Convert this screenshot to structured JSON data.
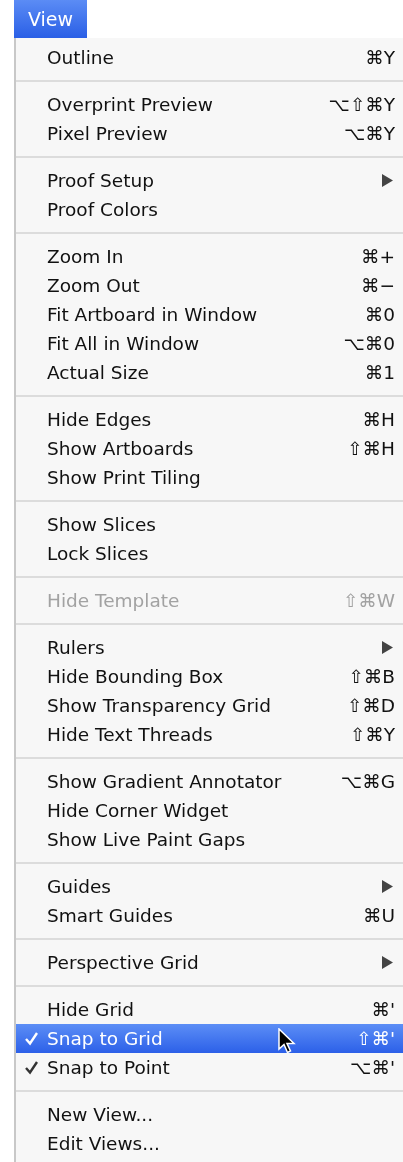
{
  "menu_title": "View",
  "sections": [
    {
      "items": [
        {
          "label": "Outline",
          "shortcut": "⌘Y",
          "submenu": false,
          "checked": false,
          "disabled": false,
          "selected": false
        }
      ]
    },
    {
      "items": [
        {
          "label": "Overprint Preview",
          "shortcut": "⌥⇧⌘Y",
          "submenu": false,
          "checked": false,
          "disabled": false,
          "selected": false
        },
        {
          "label": "Pixel Preview",
          "shortcut": "⌥⌘Y",
          "submenu": false,
          "checked": false,
          "disabled": false,
          "selected": false
        }
      ]
    },
    {
      "items": [
        {
          "label": "Proof Setup",
          "submenu": true,
          "checked": false,
          "disabled": false,
          "selected": false
        },
        {
          "label": "Proof Colors",
          "submenu": false,
          "checked": false,
          "disabled": false,
          "selected": false
        }
      ]
    },
    {
      "items": [
        {
          "label": "Zoom In",
          "shortcut": "⌘+",
          "submenu": false,
          "checked": false,
          "disabled": false,
          "selected": false
        },
        {
          "label": "Zoom Out",
          "shortcut": "⌘−",
          "submenu": false,
          "checked": false,
          "disabled": false,
          "selected": false
        },
        {
          "label": "Fit Artboard in Window",
          "shortcut": "⌘0",
          "submenu": false,
          "checked": false,
          "disabled": false,
          "selected": false
        },
        {
          "label": "Fit All in Window",
          "shortcut": "⌥⌘0",
          "submenu": false,
          "checked": false,
          "disabled": false,
          "selected": false
        },
        {
          "label": "Actual Size",
          "shortcut": "⌘1",
          "submenu": false,
          "checked": false,
          "disabled": false,
          "selected": false
        }
      ]
    },
    {
      "items": [
        {
          "label": "Hide Edges",
          "shortcut": "⌘H",
          "submenu": false,
          "checked": false,
          "disabled": false,
          "selected": false
        },
        {
          "label": "Show Artboards",
          "shortcut": "⇧⌘H",
          "submenu": false,
          "checked": false,
          "disabled": false,
          "selected": false
        },
        {
          "label": "Show Print Tiling",
          "submenu": false,
          "checked": false,
          "disabled": false,
          "selected": false
        }
      ]
    },
    {
      "items": [
        {
          "label": "Show Slices",
          "submenu": false,
          "checked": false,
          "disabled": false,
          "selected": false
        },
        {
          "label": "Lock Slices",
          "submenu": false,
          "checked": false,
          "disabled": false,
          "selected": false
        }
      ]
    },
    {
      "items": [
        {
          "label": "Hide Template",
          "shortcut": "⇧⌘W",
          "submenu": false,
          "checked": false,
          "disabled": true,
          "selected": false
        }
      ]
    },
    {
      "items": [
        {
          "label": "Rulers",
          "submenu": true,
          "checked": false,
          "disabled": false,
          "selected": false
        },
        {
          "label": "Hide Bounding Box",
          "shortcut": "⇧⌘B",
          "submenu": false,
          "checked": false,
          "disabled": false,
          "selected": false
        },
        {
          "label": "Show Transparency Grid",
          "shortcut": "⇧⌘D",
          "submenu": false,
          "checked": false,
          "disabled": false,
          "selected": false
        },
        {
          "label": "Hide Text Threads",
          "shortcut": "⇧⌘Y",
          "submenu": false,
          "checked": false,
          "disabled": false,
          "selected": false
        }
      ]
    },
    {
      "items": [
        {
          "label": "Show Gradient Annotator",
          "shortcut": "⌥⌘G",
          "submenu": false,
          "checked": false,
          "disabled": false,
          "selected": false
        },
        {
          "label": "Hide Corner Widget",
          "submenu": false,
          "checked": false,
          "disabled": false,
          "selected": false
        },
        {
          "label": "Show Live Paint Gaps",
          "submenu": false,
          "checked": false,
          "disabled": false,
          "selected": false
        }
      ]
    },
    {
      "items": [
        {
          "label": "Guides",
          "submenu": true,
          "checked": false,
          "disabled": false,
          "selected": false
        },
        {
          "label": "Smart Guides",
          "shortcut": "⌘U",
          "submenu": false,
          "checked": false,
          "disabled": false,
          "selected": false
        }
      ]
    },
    {
      "items": [
        {
          "label": "Perspective Grid",
          "submenu": true,
          "checked": false,
          "disabled": false,
          "selected": false
        }
      ]
    },
    {
      "items": [
        {
          "label": "Hide Grid",
          "shortcut": "⌘'",
          "submenu": false,
          "checked": false,
          "disabled": false,
          "selected": false
        },
        {
          "label": "Snap to Grid",
          "shortcut": "⇧⌘'",
          "submenu": false,
          "checked": true,
          "disabled": false,
          "selected": true
        },
        {
          "label": "Snap to Point",
          "shortcut": "⌥⌘'",
          "submenu": false,
          "checked": true,
          "disabled": false,
          "selected": false
        }
      ]
    },
    {
      "items": [
        {
          "label": "New View...",
          "submenu": false,
          "checked": false,
          "disabled": false,
          "selected": false
        },
        {
          "label": "Edit Views...",
          "submenu": false,
          "checked": false,
          "disabled": false,
          "selected": false
        }
      ]
    }
  ]
}
